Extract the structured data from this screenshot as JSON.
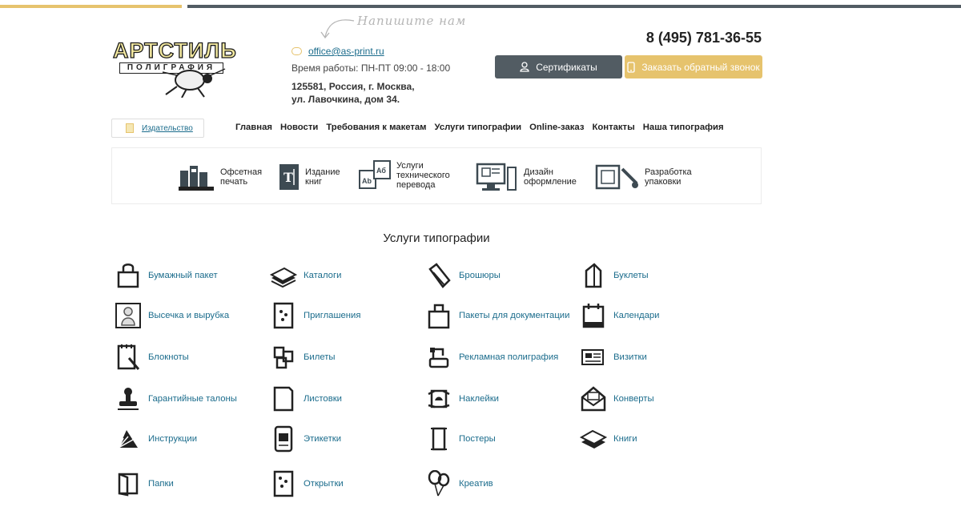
{
  "header": {
    "logo_brand": "АРТСТИЛЬ",
    "logo_sub": "ПОЛИГРАФИЯ",
    "write_us": "Напишите нам",
    "email": "office@as-print.ru",
    "hours": "Время работы: ПН-ПТ 09:00 - 18:00",
    "address_line1": "125581, Россия, г. Москва,",
    "address_line2": "ул. Лавочкина, дом 34.",
    "phone": "8 (495) 781-36-55",
    "certificates_label": "Сертификаты",
    "callback_label": "Заказать обратный звонок"
  },
  "colors": {
    "gold": "#e6c36d",
    "dark": "#525c63",
    "link": "#1b6c8c"
  },
  "izd_link": "Издательство",
  "nav": [
    "Главная",
    "Новости",
    "Требования к макетам",
    "Услуги типографии",
    "Online-заказ",
    "Контакты",
    "Наша типография"
  ],
  "services": [
    {
      "line1": "Офсетная",
      "line2": "печать",
      "line3": "",
      "icon": "printing-press-icon"
    },
    {
      "line1": "Издание",
      "line2": "книг",
      "line3": "",
      "icon": "book-icon"
    },
    {
      "line1": "Услуги",
      "line2": "технического",
      "line3": "перевода",
      "icon": "translation-icon"
    },
    {
      "line1": "Дизайн",
      "line2": "оформление",
      "line3": "",
      "icon": "computer-design-icon"
    },
    {
      "line1": "Разработка",
      "line2": "упаковки",
      "line3": "",
      "icon": "packaging-icon"
    }
  ],
  "section_title": "Услуги типографии",
  "categories": [
    {
      "label": "Бумажный пакет",
      "icon": "paper-bag-icon"
    },
    {
      "label": "Каталоги",
      "icon": "catalog-icon"
    },
    {
      "label": "Брошюры",
      "icon": "brochure-icon"
    },
    {
      "label": "Буклеты",
      "icon": "booklet-icon"
    },
    {
      "label": "Высечка и вырубка",
      "icon": "die-cut-icon"
    },
    {
      "label": "Приглашения",
      "icon": "invitation-icon"
    },
    {
      "label": "Пакеты для документации",
      "icon": "document-bag-icon"
    },
    {
      "label": "Календари",
      "icon": "calendar-icon"
    },
    {
      "label": "Блокноты",
      "icon": "notepad-icon"
    },
    {
      "label": "Билеты",
      "icon": "tickets-icon"
    },
    {
      "label": "Рекламная полиграфия",
      "icon": "advertising-icon"
    },
    {
      "label": "Визитки",
      "icon": "business-card-icon"
    },
    {
      "label": "Гарантийные талоны",
      "icon": "stamp-icon"
    },
    {
      "label": "Листовки",
      "icon": "leaflet-icon"
    },
    {
      "label": "Наклейки",
      "icon": "sticker-icon"
    },
    {
      "label": "Конверты",
      "icon": "envelope-icon"
    },
    {
      "label": "Инструкции",
      "icon": "instructions-icon"
    },
    {
      "label": "Этикетки",
      "icon": "label-icon"
    },
    {
      "label": "Постеры",
      "icon": "poster-icon"
    },
    {
      "label": "Книги",
      "icon": "books-icon"
    },
    {
      "label": "Папки",
      "icon": "folder-icon"
    },
    {
      "label": "Открытки",
      "icon": "postcard-icon"
    },
    {
      "label": "Креатив",
      "icon": "balloons-icon"
    }
  ]
}
